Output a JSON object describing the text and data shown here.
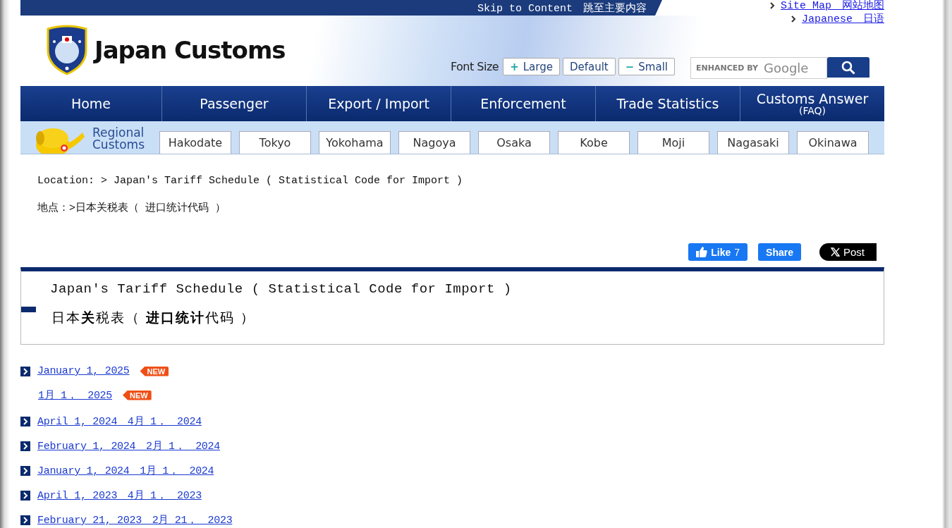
{
  "top_bar": {
    "skip_link": "Skip to Content　跳至主要内容"
  },
  "utility_links": [
    {
      "label": "Site Map　网站地图"
    },
    {
      "label": "Japanese　日语"
    }
  ],
  "header": {
    "site_title": "Japan Customs",
    "font_size": {
      "label": "Font Size",
      "options": [
        {
          "sign": "+",
          "label": "Large"
        },
        {
          "label": "Default"
        },
        {
          "sign": "−",
          "label": "Small"
        }
      ]
    },
    "search": {
      "brand_prefix": "ENHANCED BY",
      "brand_name": "Google"
    }
  },
  "nav": [
    {
      "label": "Home"
    },
    {
      "label": "Passenger"
    },
    {
      "label": "Export / Import"
    },
    {
      "label": "Enforcement"
    },
    {
      "label": "Trade Statistics"
    },
    {
      "label": "Customs Answer",
      "sublabel": "(FAQ)"
    }
  ],
  "regional": {
    "title": "Regional Customs",
    "offices": [
      "Hakodate",
      "Tokyo",
      "Yokohama",
      "Nagoya",
      "Osaka",
      "Kobe",
      "Moji",
      "Nagasaki",
      "Okinawa"
    ]
  },
  "breadcrumb": [
    "Location:  > Japan's Tariff Schedule ( Statistical Code for Import )",
    "地点：>日本关税表（ 进口统计代码 ）"
  ],
  "social": {
    "like": "Like",
    "like_count": "7",
    "share": "Share",
    "post": "Post"
  },
  "page_title": {
    "english": "Japan's Tariff Schedule ( Statistical Code for Import )",
    "chinese": "日本**关**税表（ **进口统计**代码 ）"
  },
  "releases": [
    {
      "kind": "entry",
      "label": "January 1, 2025",
      "new": true,
      "badge": "NEW"
    },
    {
      "kind": "continuation",
      "label": "1月 1，　2025",
      "new": true,
      "badge": "NEW"
    },
    {
      "kind": "entry",
      "label": "April 1, 2024　4月 1，　2024",
      "new": false
    },
    {
      "kind": "entry",
      "label": "February 1, 2024　2月 1，　2024",
      "new": false
    },
    {
      "kind": "entry",
      "label": "January 1, 2024　1月 1，　2024",
      "new": false
    },
    {
      "kind": "entry",
      "label": "April 1, 2023　4月 1，　2023",
      "new": false
    },
    {
      "kind": "entry",
      "label": "February 21, 2023　2月 21，　2023",
      "new": false
    }
  ]
}
